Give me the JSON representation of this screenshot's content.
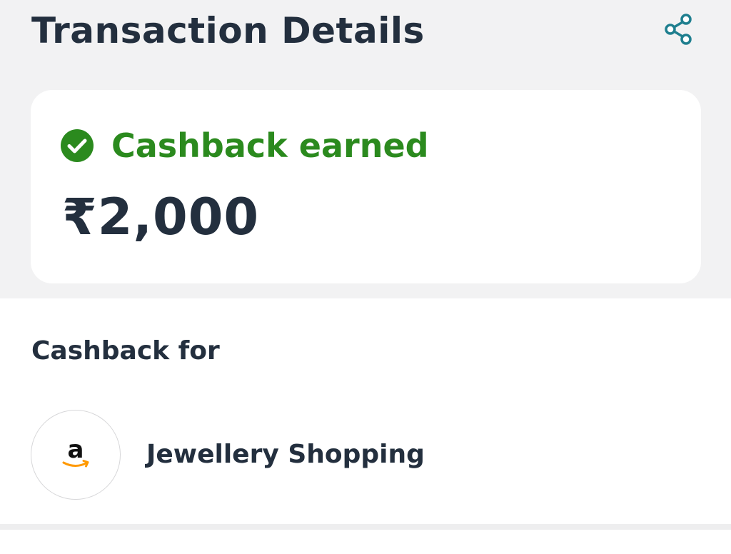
{
  "header": {
    "title": "Transaction Details",
    "share_icon": "share-icon"
  },
  "cashback_card": {
    "status_icon": "check-circle-icon",
    "status": "Cashback earned",
    "amount": "₹2,000"
  },
  "cashback_for": {
    "heading": "Cashback for",
    "merchant": {
      "logo_icon": "amazon-logo-icon",
      "name": "Jewellery Shopping"
    }
  },
  "colors": {
    "title_text": "#232f3e",
    "success_green": "#2b8a1e",
    "share_teal": "#1f7f8f",
    "amazon_orange": "#ff9900",
    "top_background": "#f2f2f3"
  }
}
